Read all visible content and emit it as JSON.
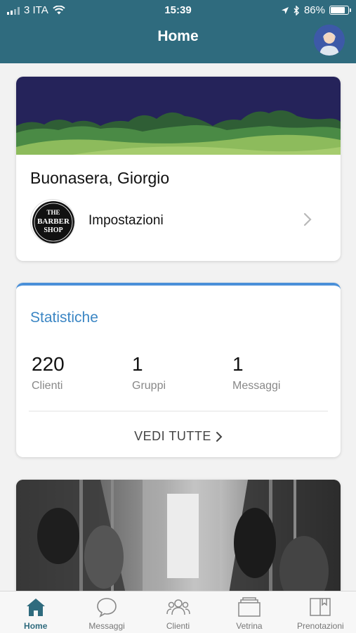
{
  "status_bar": {
    "carrier": "3 ITA",
    "time": "15:39",
    "battery": "86%",
    "battery_level": 0.86
  },
  "header": {
    "title": "Home"
  },
  "welcome_card": {
    "greeting": "Buonasera, Giorgio",
    "settings_label": "Impostazioni",
    "logo_text": [
      "THE",
      "BARBER",
      "SHOP"
    ]
  },
  "stats": {
    "title": "Statistiche",
    "items": [
      {
        "value": "220",
        "label": "Clienti"
      },
      {
        "value": "1",
        "label": "Gruppi"
      },
      {
        "value": "1",
        "label": "Messaggi"
      }
    ],
    "see_all": "VEDI TUTTE"
  },
  "tabs": [
    {
      "label": "Home",
      "icon": "home-icon",
      "active": true
    },
    {
      "label": "Messaggi",
      "icon": "chat-bubble-icon",
      "active": false
    },
    {
      "label": "Clienti",
      "icon": "people-icon",
      "active": false
    },
    {
      "label": "Vetrina",
      "icon": "showcase-icon",
      "active": false
    },
    {
      "label": "Prenotazioni",
      "icon": "book-icon",
      "active": false
    }
  ],
  "colors": {
    "header": "#2f6b7e",
    "accent": "#3b86c4",
    "stats_border": "#4a90d9"
  }
}
